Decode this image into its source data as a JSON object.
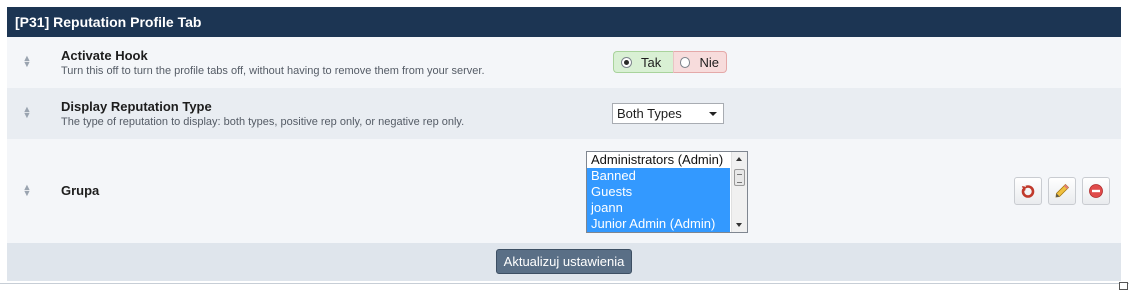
{
  "panel": {
    "title": "[P31] Reputation Profile Tab"
  },
  "settings": {
    "activate_hook": {
      "title": "Activate Hook",
      "description": "Turn this off to turn the profile tabs off, without having to remove them from your server.",
      "yes_label": "Tak",
      "no_label": "Nie",
      "selected": "Tak"
    },
    "display_type": {
      "title": "Display Reputation Type",
      "description": "The type of reputation to display: both types, positive rep only, or negative rep only.",
      "selected": "Both Types"
    },
    "group": {
      "title": "Grupa",
      "options": [
        {
          "label": "Administrators (Admin)",
          "selected": false
        },
        {
          "label": "Banned",
          "selected": true
        },
        {
          "label": "Guests",
          "selected": true
        },
        {
          "label": "joann",
          "selected": true
        },
        {
          "label": "Junior Admin (Admin)",
          "selected": true
        }
      ]
    }
  },
  "footer": {
    "submit_label": "Aktualizuj ustawienia"
  },
  "icons": {
    "handle": "drag-handle-icon",
    "revert": "revert-icon",
    "edit": "pencil-icon",
    "delete": "delete-icon"
  },
  "colors": {
    "header_bg": "#1c3553",
    "selected_bg": "#3399ff",
    "yes_bg": "#d9f0d4",
    "no_bg": "#f7dcdc",
    "button_bg": "#5a6f86"
  }
}
